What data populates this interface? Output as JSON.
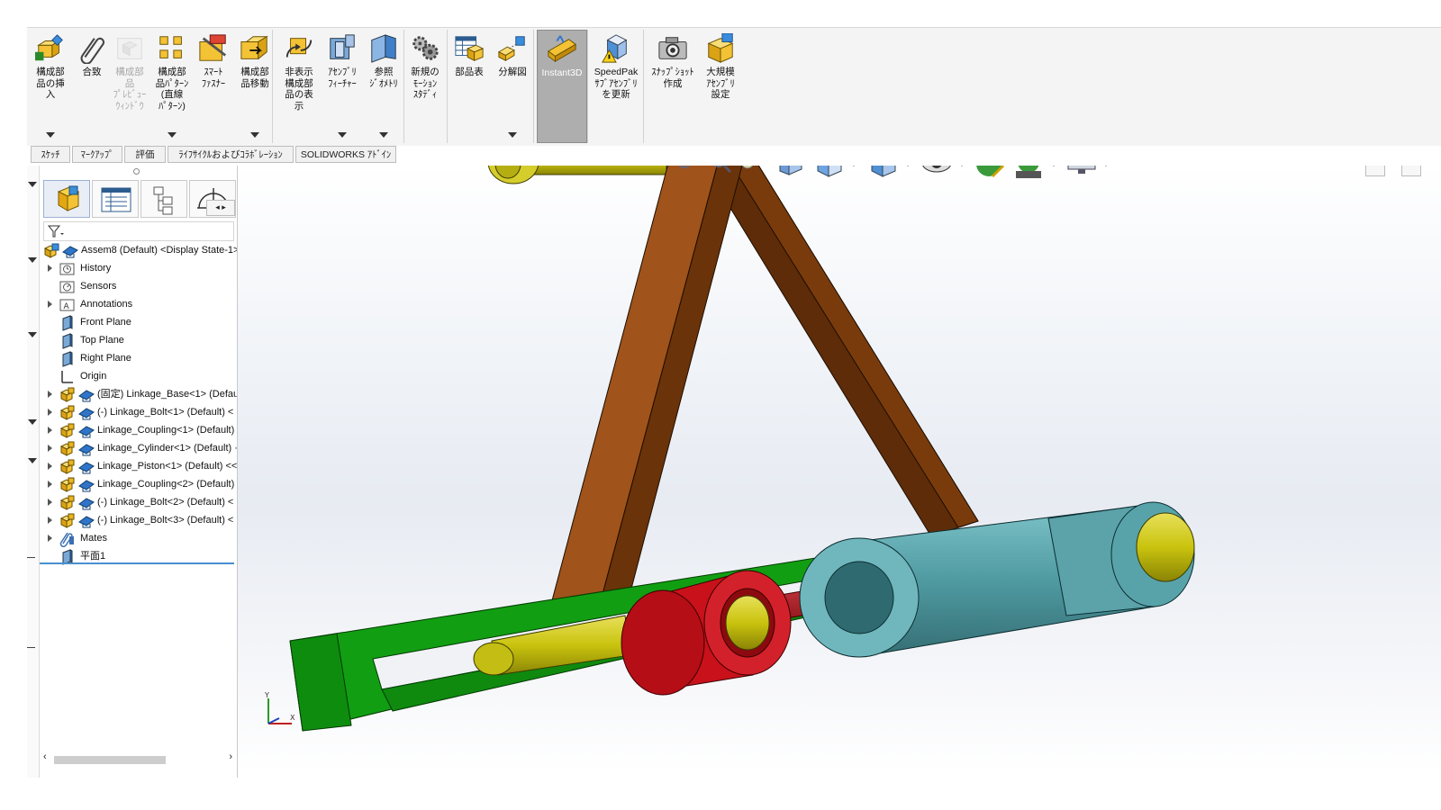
{
  "ribbon": {
    "commands": [
      {
        "name": "insert-components",
        "label": "構成部\n品の挿\n入",
        "icon": "insert-component-icon",
        "disabled": false,
        "caret": true
      },
      {
        "name": "mate",
        "label": "合致",
        "icon": "paperclip-mate-icon",
        "disabled": false,
        "caret": false
      },
      {
        "name": "component-preview",
        "label": "構成部\n品\nﾌﾟﾚﾋﾞｭｰ\nｳｨﾝﾄﾞｳ",
        "icon": "component-preview-icon",
        "disabled": true,
        "caret": false
      },
      {
        "name": "linear-pattern",
        "label": "構成部\n品ﾊﾟﾀｰﾝ\n(直線\nﾊﾟﾀｰﾝ)",
        "icon": "linear-pattern-icon",
        "disabled": false,
        "caret": true
      },
      {
        "name": "smart-fasteners",
        "label": "ｽﾏｰﾄ\nﾌｧｽﾅｰ",
        "icon": "smart-fastener-icon",
        "disabled": false,
        "caret": false
      },
      {
        "name": "move-component",
        "label": "構成部\n品移動",
        "icon": "move-component-icon",
        "disabled": false,
        "caret": true
      },
      {
        "name": "show-hidden",
        "label": "非表示\n構成部\n品の表\n示",
        "icon": "show-hidden-icon",
        "disabled": false,
        "caret": false
      },
      {
        "name": "assembly-features",
        "label": "ｱｾﾝﾌﾞﾘ\nﾌｨｰﾁｬｰ",
        "icon": "assembly-feature-icon",
        "disabled": false,
        "caret": true
      },
      {
        "name": "reference-geometry",
        "label": "参照\nｼﾞｵﾒﾄﾘ",
        "icon": "reference-geometry-icon",
        "disabled": false,
        "caret": true
      },
      {
        "name": "new-motion-study",
        "label": "新規の\nﾓｰｼｮﾝ\nｽﾀﾃﾞｨ",
        "icon": "gears-icon",
        "disabled": false,
        "caret": false
      },
      {
        "name": "bill-of-materials",
        "label": "部品表",
        "icon": "bom-table-icon",
        "disabled": false,
        "caret": false
      },
      {
        "name": "exploded-view",
        "label": "分解図",
        "icon": "exploded-view-icon",
        "disabled": false,
        "caret": true
      },
      {
        "name": "instant3d",
        "label": "Instant3D",
        "icon": "instant3d-icon",
        "disabled": false,
        "caret": false,
        "active": true
      },
      {
        "name": "update-speedpak",
        "label": "SpeedPak\nｻﾌﾞｱｾﾝﾌﾞﾘ\nを更新",
        "icon": "speedpak-warning-icon",
        "disabled": false,
        "caret": false
      },
      {
        "name": "take-snapshot",
        "label": "ｽﾅｯﾌﾟｼｮｯﾄ\n作成",
        "icon": "camera-icon",
        "disabled": false,
        "caret": false
      },
      {
        "name": "large-assembly",
        "label": "大規模\nｱｾﾝﾌﾞﾘ\n設定",
        "icon": "large-assembly-icon",
        "disabled": false,
        "caret": false
      }
    ]
  },
  "tabs": [
    "ｽｹｯﾁ",
    "ﾏｰｸｱｯﾌﾟ",
    "評価",
    "ﾗｲﾌｻｲｸﾙおよびｺﾗﾎﾞﾚｰｼｮﾝ",
    "SOLIDWORKS ｱﾄﾞｲﾝ"
  ],
  "tree": {
    "root": "Assem8 (Default) <Display State-1>",
    "items": [
      {
        "label": "History",
        "icon": "history-folder-icon",
        "expandable": true
      },
      {
        "label": "Sensors",
        "icon": "sensors-folder-icon",
        "expandable": false
      },
      {
        "label": "Annotations",
        "icon": "annotations-folder-icon",
        "expandable": true
      },
      {
        "label": "Front Plane",
        "icon": "plane-icon",
        "expandable": false
      },
      {
        "label": "Top Plane",
        "icon": "plane-icon",
        "expandable": false
      },
      {
        "label": "Right Plane",
        "icon": "plane-icon",
        "expandable": false
      },
      {
        "label": "Origin",
        "icon": "origin-icon",
        "expandable": false
      },
      {
        "label": "(固定) Linkage_Base<1> (Defau",
        "icon": "part-icon",
        "expandable": true,
        "component": true
      },
      {
        "label": "(-) Linkage_Bolt<1> (Default) <",
        "icon": "part-icon",
        "expandable": true,
        "component": true
      },
      {
        "label": "Linkage_Coupling<1> (Default)",
        "icon": "part-icon",
        "expandable": true,
        "component": true
      },
      {
        "label": "Linkage_Cylinder<1> (Default) ·",
        "icon": "part-icon",
        "expandable": true,
        "component": true
      },
      {
        "label": "Linkage_Piston<1> (Default) <<",
        "icon": "part-icon",
        "expandable": true,
        "component": true
      },
      {
        "label": "Linkage_Coupling<2> (Default)",
        "icon": "part-icon",
        "expandable": true,
        "component": true
      },
      {
        "label": "(-) Linkage_Bolt<2> (Default) <",
        "icon": "part-icon",
        "expandable": true,
        "component": true
      },
      {
        "label": "(-) Linkage_Bolt<3> (Default) <",
        "icon": "part-icon",
        "expandable": true,
        "component": true
      },
      {
        "label": "Mates",
        "icon": "mates-folder-icon",
        "expandable": true
      },
      {
        "label": "平面1",
        "icon": "plane-icon",
        "expandable": false
      }
    ]
  },
  "colors": {
    "base_green": "#129e12",
    "bar_brown": "#8f4a15",
    "bolt_yellow": "#c9c30e",
    "coupling_red": "#c8111a",
    "cylinder_teal": "#57a6ad",
    "piston_red": "#9e0d10",
    "active_cmd": "#aeaeae",
    "tree_end_line": "#4a8fd0"
  }
}
